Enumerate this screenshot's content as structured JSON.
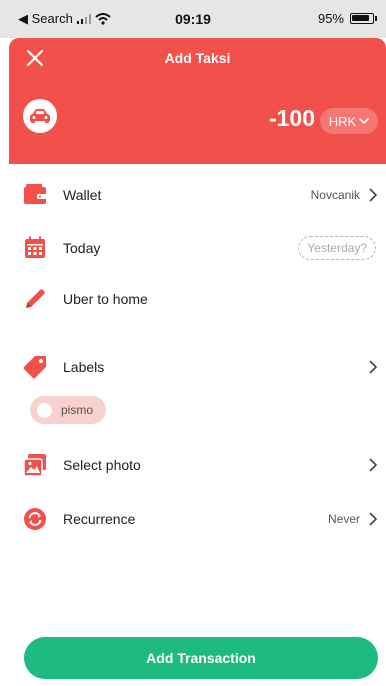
{
  "status_bar": {
    "back_label": "◀ Search",
    "time": "09:19",
    "battery": "95%"
  },
  "header": {
    "title": "Add Taksi",
    "amount": "-100",
    "currency": "HRK",
    "color": "#f2504b"
  },
  "rows": {
    "wallet": {
      "label": "Wallet",
      "value": "Novcanik"
    },
    "date": {
      "label": "Today",
      "alt": "Yesterday?"
    },
    "note": {
      "label": "Uber to home"
    },
    "labels": {
      "label": "Labels",
      "chips": [
        "pismo"
      ]
    },
    "photo": {
      "label": "Select photo"
    },
    "recurrence": {
      "label": "Recurrence",
      "value": "Never"
    }
  },
  "icons": {
    "close": "close-icon",
    "car": "car-icon",
    "wallet": "wallet-icon",
    "calendar": "calendar-icon",
    "pencil": "pencil-icon",
    "tag": "tag-icon",
    "photo": "photo-icon",
    "recurrence": "recurrence-icon"
  },
  "footer": {
    "add_button": "Add Transaction",
    "color": "#1dbb80"
  }
}
